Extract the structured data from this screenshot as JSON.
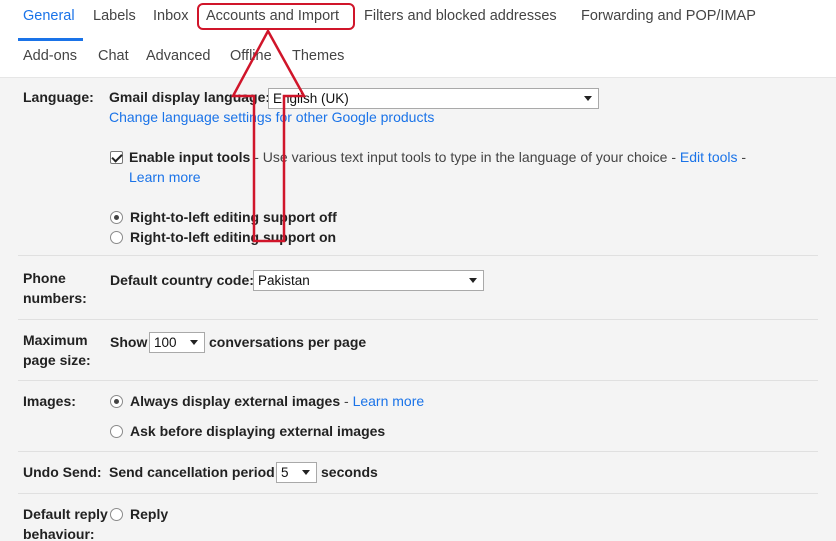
{
  "tabs": {
    "row1": [
      "General",
      "Labels",
      "Inbox",
      "Accounts and Import",
      "Filters and blocked addresses",
      "Forwarding and POP/IMAP"
    ],
    "row2": [
      "Add-ons",
      "Chat",
      "Advanced",
      "Offline",
      "Themes"
    ],
    "active": "General",
    "highlighted": "Accounts and Import"
  },
  "language": {
    "label": "Language:",
    "display_label": "Gmail display language:",
    "display_value": "English (UK)",
    "change_link": "Change language settings for other Google products",
    "input_tools_label": "Enable input tools",
    "input_tools_checked": true,
    "input_tools_desc": " - Use various text input tools to type in the language of your choice - ",
    "edit_tools_link": "Edit tools",
    "dash": " -",
    "learn_more": "Learn more",
    "rtl_off": "Right-to-left editing support off",
    "rtl_on": "Right-to-left editing support on",
    "rtl_selected": "off"
  },
  "phone": {
    "label_line1": "Phone",
    "label_line2": "numbers:",
    "country_label": "Default country code:",
    "country_value": "Pakistan"
  },
  "page_size": {
    "label_line1": "Maximum",
    "label_line2": "page size:",
    "show": "Show",
    "value": "100",
    "suffix": "conversations per page"
  },
  "images": {
    "label": "Images:",
    "always": "Always display external images",
    "dash": " - ",
    "learn_more": "Learn more",
    "ask": "Ask before displaying external images",
    "selected": "always"
  },
  "undo_send": {
    "label": "Undo Send:",
    "period_label": "Send cancellation period:",
    "value": "5",
    "suffix": "seconds"
  },
  "reply": {
    "label_line1": "Default reply",
    "label_line2": "behaviour:",
    "option": "Reply"
  },
  "annotation": {
    "color": "#d0152a"
  }
}
